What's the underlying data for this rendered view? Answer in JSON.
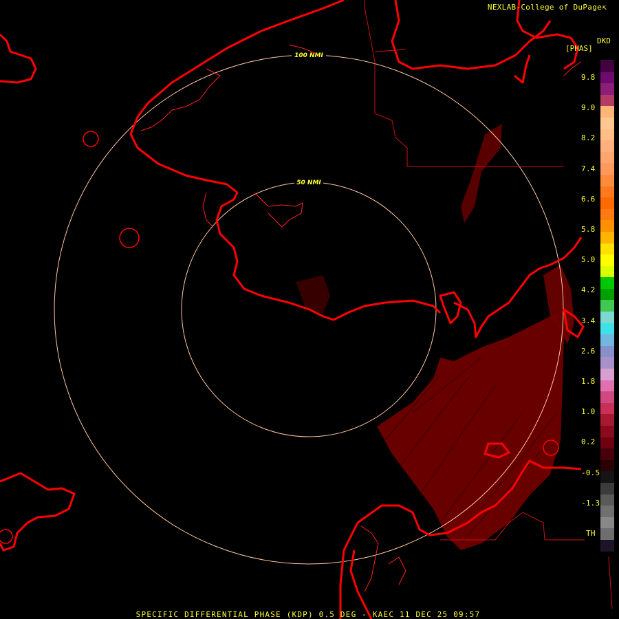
{
  "credit": "NEXLAB-College of DuPage",
  "credit_icon": "cursor-arrow-icon",
  "units": {
    "code": "DKD",
    "name": "[PHAS]"
  },
  "footer": "SPECIFIC DIFFERENTIAL PHASE (KDP) 0.5 DEG - KAEC 11 DEC 25 09:57",
  "range_rings": [
    {
      "label": "100 NMI"
    },
    {
      "label": "50 NMI"
    }
  ],
  "colorbar": {
    "ticks": [
      "9.8",
      "9.0",
      "8.2",
      "7.4",
      "6.6",
      "5.8",
      "5.0",
      "4.2",
      "3.4",
      "2.6",
      "1.8",
      "1.0",
      "0.2",
      "-0.5",
      "-1.3",
      "TH"
    ],
    "colors": [
      "#420042",
      "#6e0a6e",
      "#8c1e78",
      "#b43c64",
      "#ffb478",
      "#ffc890",
      "#ffbe88",
      "#ffb07c",
      "#ffa66e",
      "#ff9a5c",
      "#ff8c3c",
      "#ff7a1e",
      "#ff6a00",
      "#ff7a10",
      "#ff9000",
      "#ffb400",
      "#ffe000",
      "#ffff00",
      "#d8ff00",
      "#00c800",
      "#00a000",
      "#40c850",
      "#7cd8d0",
      "#40e0e8",
      "#70b8e0",
      "#8890c8",
      "#a890c8",
      "#d8a0d0",
      "#e070b0",
      "#d04880",
      "#c83058",
      "#a81830",
      "#8c0a1e",
      "#6e0010",
      "#460008",
      "#2a0004",
      "#141414",
      "#3c3c3c",
      "#5a5a5a",
      "#707070",
      "#888888",
      "#6e6e6e",
      "#1e1428"
    ]
  },
  "colors": {
    "background": "#000000",
    "boundary": "#ff0000",
    "coastline_thin": "#ff2020",
    "ring": "#ffc8a0",
    "echo": "#6e0000",
    "label": "#ffff33"
  }
}
